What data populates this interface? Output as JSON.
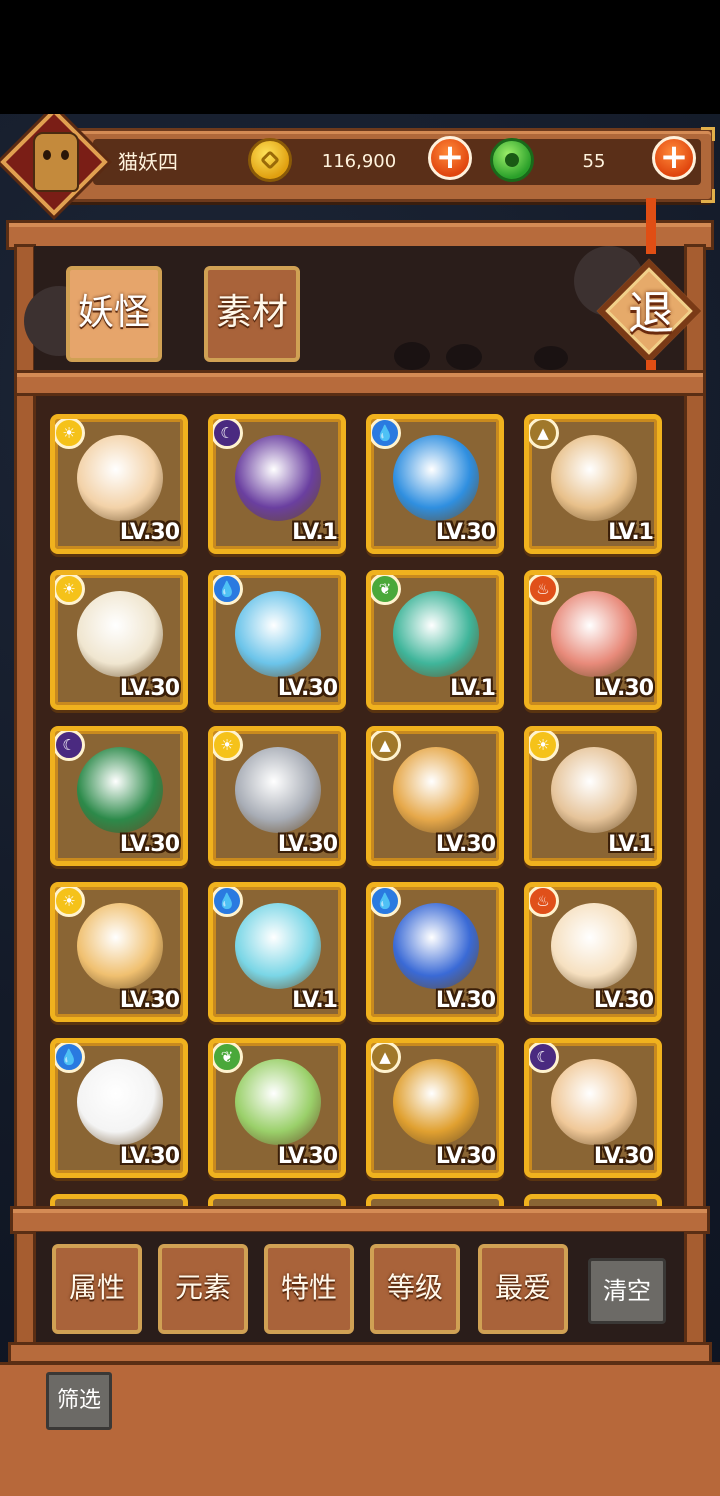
{
  "player": {
    "name": "猫妖四"
  },
  "resources": {
    "coins": "116,900",
    "jade": "55",
    "plus_label": "+"
  },
  "tabs": [
    {
      "label": "妖怪",
      "active": true
    },
    {
      "label": "素材",
      "active": false
    }
  ],
  "exit_label": "退",
  "monsters": [
    {
      "element": "sun",
      "level": "LV.30",
      "color": "#f3d2a8"
    },
    {
      "element": "moon",
      "level": "LV.1",
      "color": "#6a3fa0"
    },
    {
      "element": "water",
      "level": "LV.30",
      "color": "#2f8fe0"
    },
    {
      "element": "earth",
      "level": "LV.1",
      "color": "#e8c08a"
    },
    {
      "element": "sun",
      "level": "LV.30",
      "color": "#f0e6d0"
    },
    {
      "element": "water",
      "level": "LV.30",
      "color": "#6bc4ea"
    },
    {
      "element": "wood",
      "level": "LV.1",
      "color": "#3fb59a"
    },
    {
      "element": "fire",
      "level": "LV.30",
      "color": "#e88a7a"
    },
    {
      "element": "moon",
      "level": "LV.30",
      "color": "#2c8a4a"
    },
    {
      "element": "sun",
      "level": "LV.30",
      "color": "#a8adb6"
    },
    {
      "element": "earth",
      "level": "LV.30",
      "color": "#e6a84a"
    },
    {
      "element": "sun",
      "level": "LV.1",
      "color": "#e6c49a"
    },
    {
      "element": "sun",
      "level": "LV.30",
      "color": "#f0c070"
    },
    {
      "element": "water",
      "level": "LV.1",
      "color": "#7ad6e6"
    },
    {
      "element": "water",
      "level": "LV.30",
      "color": "#3a6ad6"
    },
    {
      "element": "fire",
      "level": "LV.30",
      "color": "#f6e0c0"
    },
    {
      "element": "water",
      "level": "LV.30",
      "color": "#f4f4f4"
    },
    {
      "element": "wood",
      "level": "LV.30",
      "color": "#9ad06a"
    },
    {
      "element": "earth",
      "level": "LV.30",
      "color": "#e0a030"
    },
    {
      "element": "moon",
      "level": "LV.30",
      "color": "#f0c898"
    }
  ],
  "element_icons": {
    "sun": {
      "glyph": "☀",
      "color": "#f5c21a"
    },
    "moon": {
      "glyph": "☾",
      "color": "#4a2a80"
    },
    "water": {
      "glyph": "💧",
      "color": "#2a7ae0"
    },
    "earth": {
      "glyph": "▲",
      "color": "#a0782a"
    },
    "wood": {
      "glyph": "❦",
      "color": "#4aa83a"
    },
    "fire": {
      "glyph": "♨",
      "color": "#e0501a"
    }
  },
  "filters": [
    {
      "label": "属性"
    },
    {
      "label": "元素"
    },
    {
      "label": "特性"
    },
    {
      "label": "等级"
    },
    {
      "label": "最爱"
    }
  ],
  "clear_label": "清空",
  "screen_label": "筛选"
}
